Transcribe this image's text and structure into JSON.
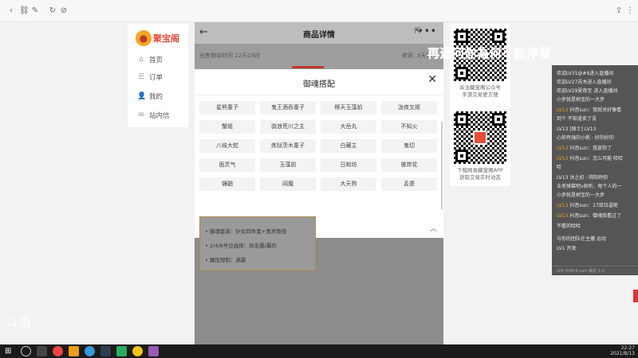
{
  "browser": {
    "icons": [
      "back-icon",
      "forward-icon",
      "link-icon",
      "pen-icon",
      "refresh-icon",
      "stop-icon",
      "share-icon",
      "menu-icon"
    ]
  },
  "nav": {
    "logo_text": "聚宝阁",
    "items": [
      {
        "label": "首页",
        "icon": "home-icon"
      },
      {
        "label": "订单",
        "icon": "order-icon"
      },
      {
        "label": "我的",
        "icon": "user-icon"
      },
      {
        "label": "站内信",
        "icon": "mail-icon"
      }
    ]
  },
  "phone": {
    "title": "商品详情",
    "sub_left": "出售剩余时间 12天19时",
    "sub_right": "卖家: 3天17日",
    "modal": {
      "title": "御魂搭配",
      "chips": [
        "星熊童子",
        "鬼王酒吞童子",
        "柳天玉藻前",
        "泷夜叉姬",
        "蟹姬",
        "骁浪荒川之主",
        "大岳丸",
        "不知火",
        "八岐大蛇",
        "炼狱茨木童子",
        "白藏主",
        "鬼切",
        "面灵气",
        "玉藻前",
        "日和坊",
        "彼岸花",
        "镰鼬",
        "阎魔",
        "大天狗",
        "孟婆"
      ]
    },
    "notes": [
      "• 御魂套装：针女四件套+鬼灵歌伎",
      "• 2/4/6号位选择：攻击暴/暴伤",
      "• 属性限制：满暴"
    ]
  },
  "qr": {
    "caption1": [
      "关注藏宝阁公众号",
      "手游交易更方便"
    ],
    "caption2": [
      "下载网易藏宝阁APP",
      "获取交易实时动态"
    ]
  },
  "overlay": "再追问你為何不能停留",
  "chat": [
    {
      "u": "",
      "t": "欢迎LV31@#$进入直播间"
    },
    {
      "u": "",
      "t": "欢迎LV27苏木进入直播间"
    },
    {
      "u": "",
      "t": "欢迎LV29夏夜至 进入直播间"
    },
    {
      "u": "",
      "t": "小步就是树宝的一大步"
    },
    {
      "u": "LV13",
      "t": "抖音sun：我就关好像看"
    },
    {
      "u": "",
      "t": "到个 不知道卖了没"
    },
    {
      "u": "",
      "t": "LV13 [骑士] LV13"
    },
    {
      "u": "",
      "t": "心你有强的小帆 : 好的好的"
    },
    {
      "u": "LV13",
      "t": "抖音sun：我放你了"
    },
    {
      "u": "LV13",
      "t": "抖音sun：怎么可能 哈哈"
    },
    {
      "u": "",
      "t": "哈"
    },
    {
      "u": "",
      "t": "LV13 沐之初 : 阴阳师你"
    },
    {
      "u": "",
      "t": "业务弹幕吧v收听，每个人的一"
    },
    {
      "u": "",
      "t": "小步就是树宝的一大步"
    },
    {
      "u": "LV13",
      "t": "抖音sun：17双日逼呢"
    },
    {
      "u": "LV13",
      "t": "抖音sun：御魂我看过了"
    },
    {
      "u": "",
      "t": "不看的哈哈"
    },
    {
      "u": "",
      "t": "与你的团队在主播 运动"
    },
    {
      "u": "",
      "t": "LV1 开发"
    }
  ],
  "chat_footer": "LV4 日99.9 sum 最近 1:5",
  "watermark": "斗鱼",
  "clock": {
    "time": "22:27",
    "date": "2021/8/13"
  }
}
